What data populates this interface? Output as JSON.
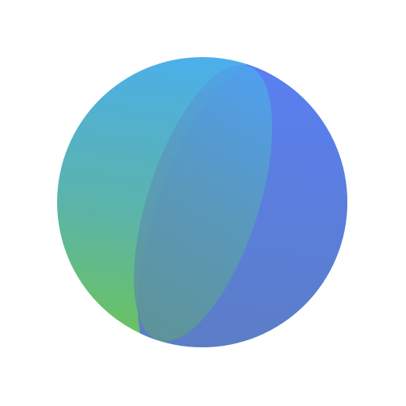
{
  "image": {
    "background": "#ffffff",
    "icon": "sphere-logo-icon",
    "colors": {
      "top_left_cyan": "#4BB1EE",
      "bottom_left_green": "#6CC55A",
      "right_blue": "#5A7BEC",
      "bottom_blue": "#5C7CC6",
      "lens_overlay": "#5C9DAA"
    }
  }
}
